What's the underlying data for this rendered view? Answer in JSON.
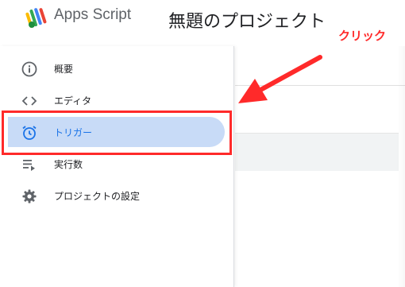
{
  "header": {
    "app_name": "Apps Script",
    "project_title": "無題のプロジェクト"
  },
  "annotation": {
    "label": "クリック",
    "color": "#ff2a2a"
  },
  "sidebar": {
    "items": [
      {
        "label": "概要",
        "icon": "info-icon"
      },
      {
        "label": "エディタ",
        "icon": "code-icon"
      },
      {
        "label": "トリガー",
        "icon": "alarm-clock-icon",
        "active": true
      },
      {
        "label": "実行数",
        "icon": "executions-list-icon"
      },
      {
        "label": "プロジェクトの設定",
        "icon": "gear-icon"
      }
    ]
  },
  "colors": {
    "accent": "#1a73e8",
    "active_bg": "#c8dbf7",
    "icon_gray": "#5f6368"
  }
}
